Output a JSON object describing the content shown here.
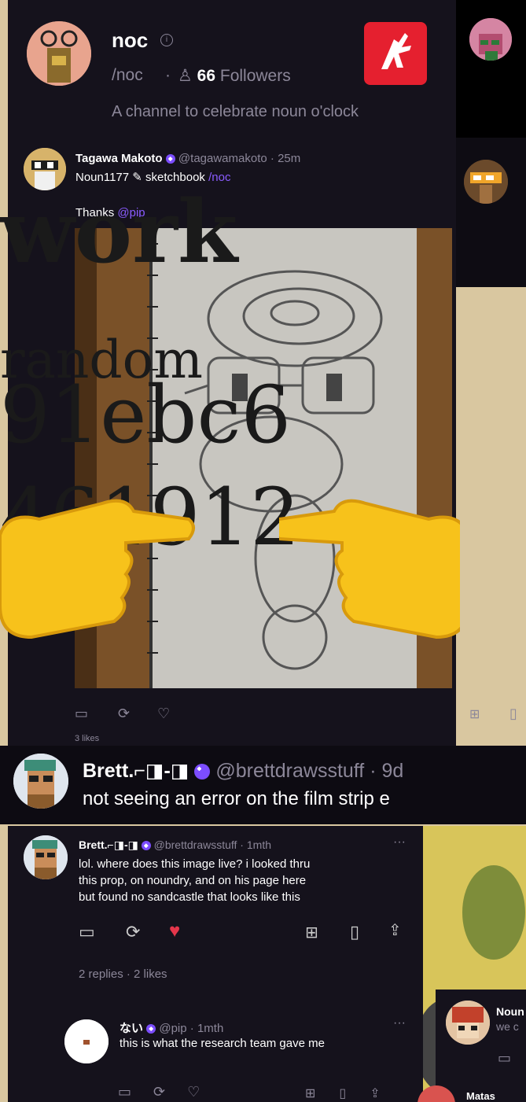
{
  "channel": {
    "name": "noc",
    "handle": "/noc",
    "followers_count": "66",
    "followers_label": "Followers",
    "description": "A channel to celebrate noun o'clock"
  },
  "post1": {
    "author": "Tagawa Makoto",
    "handle": "@tagawamakoto",
    "time": "25m",
    "subtitle_prefix": "Noun1177",
    "subtitle_mid": "sketchbook",
    "subtitle_channel": "/noc",
    "body_prefix": "Thanks",
    "body_mention": "@pip",
    "likes": "3 likes"
  },
  "overlay": {
    "line1": "work",
    "line2": "random",
    "line3": "91ebc6",
    "line4": "461912"
  },
  "post2": {
    "author": "Brett.⌐◨-◨",
    "handle": "@brettdrawsstuff",
    "time": "9d",
    "body": "not seeing an error on the film strip e"
  },
  "post3": {
    "author": "Brett.⌐◨-◨",
    "handle": "@brettdrawsstuff",
    "time": "1mth",
    "body_line1": "lol. where does this image live? i looked thru",
    "body_line2": "this prop, on noundry, and on his page here",
    "body_line3": "but found no sandcastle that looks like this",
    "stats": "2 replies · 2 likes"
  },
  "reply": {
    "author": "ない",
    "handle": "@pip",
    "time": "1mth",
    "body": "this is what the research team gave me"
  },
  "side": {
    "name1": "Noun",
    "sub1": "we c",
    "name2": "Matas"
  },
  "colors": {
    "bg": "#15121c",
    "accent": "#8a5cff",
    "like": "#e5364b",
    "emoji": "#f7c21b"
  }
}
